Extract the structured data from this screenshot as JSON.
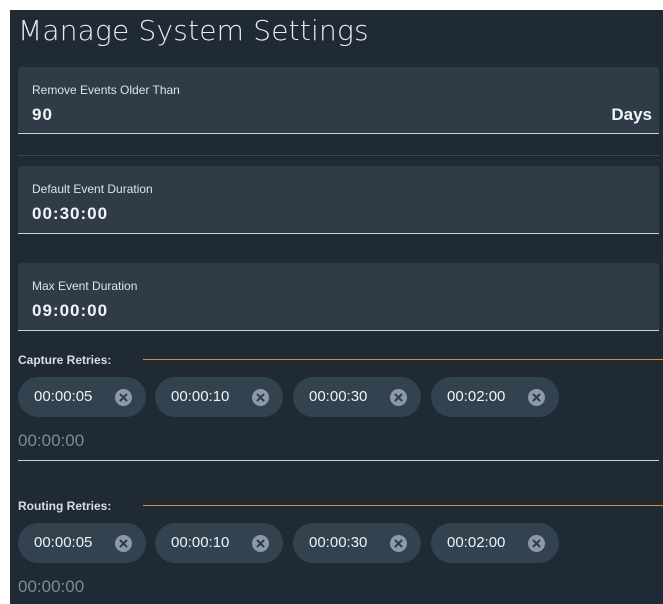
{
  "title": "Manage System Settings",
  "remove_events": {
    "label": "Remove Events Older Than",
    "value": "90",
    "suffix": "Days"
  },
  "default_duration": {
    "label": "Default Event Duration",
    "value": "00:30:00"
  },
  "max_duration": {
    "label": "Max Event Duration",
    "value": "09:00:00"
  },
  "capture_retries": {
    "label": "Capture Retries:",
    "chips": [
      "00:00:05",
      "00:00:10",
      "00:00:30",
      "00:02:00"
    ],
    "input_value": "00:00:00"
  },
  "routing_retries": {
    "label": "Routing Retries:",
    "chips": [
      "00:00:05",
      "00:00:10",
      "00:00:30",
      "00:02:00"
    ],
    "input_value": "00:00:00"
  },
  "icons": {
    "chip_remove": "close-circle-icon"
  },
  "colors": {
    "panel_background": "#1f2a35",
    "field_background": "#2f3b47",
    "chip_background": "#33424f",
    "section_accent": "#d98a3d"
  }
}
